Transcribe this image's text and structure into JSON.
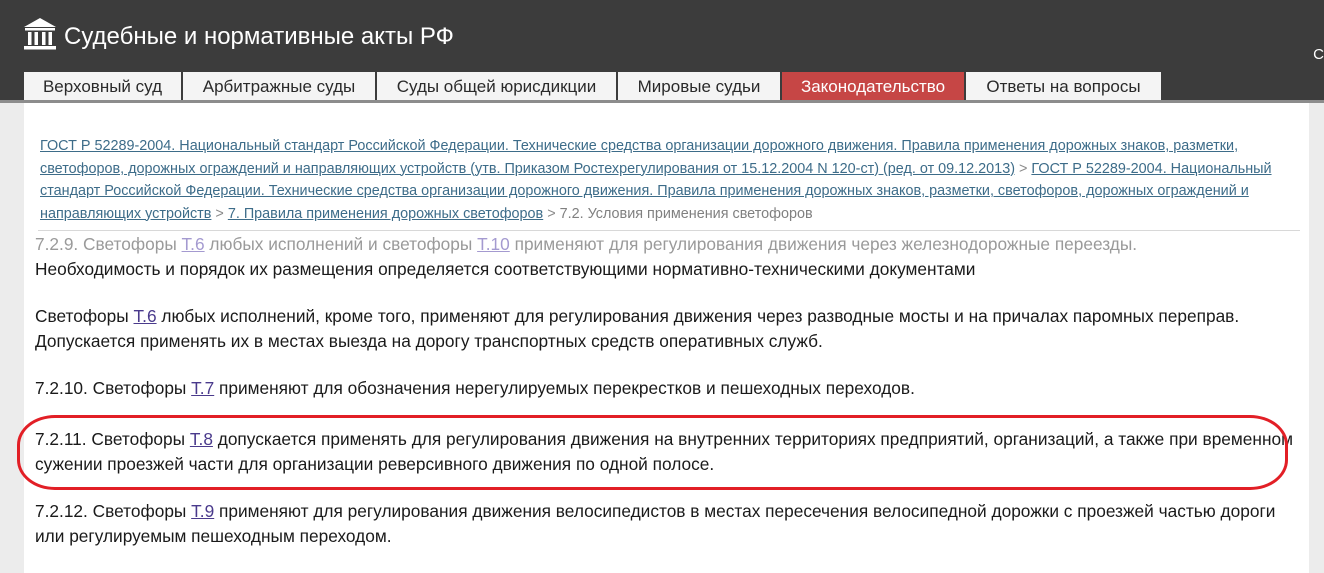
{
  "header": {
    "logo_icon": "courthouse-icon",
    "title": "Судебные и нормативные акты РФ",
    "corner_text": "С"
  },
  "nav": {
    "tabs": [
      {
        "label": "Верховный суд",
        "active": false
      },
      {
        "label": "Арбитражные суды",
        "active": false
      },
      {
        "label": "Суды общей юрисдикции",
        "active": false
      },
      {
        "label": "Мировые судьи",
        "active": false
      },
      {
        "label": "Законодательство",
        "active": true
      },
      {
        "label": "Ответы на вопросы",
        "active": false
      }
    ]
  },
  "breadcrumb": {
    "link1": "ГОСТ Р 52289-2004. Национальный стандарт Российской Федерации. Технические средства организации дорожного движения. Правила применения дорожных знаков, разметки, светофоров, дорожных ограждений и направляющих устройств (утв. Приказом Ростехрегулирования от 15.12.2004 N 120-ст) (ред. от 09.12.2013)",
    "link2": "ГОСТ Р 52289-2004. Национальный стандарт Российской Федерации. Технические средства организации дорожного движения. Правила применения дорожных знаков, разметки, светофоров, дорожных ограждений и направляющих устройств",
    "link3": "7. Правила применения дорожных светофоров",
    "current": "7.2. Условия применения светофоров",
    "separator": ">"
  },
  "content": {
    "p1": {
      "faded_a": "7.2.9. Светофоры ",
      "link_a": "Т.6",
      "faded_b": " любых исполнений и светофоры ",
      "link_b": "Т.10",
      "faded_c": " применяют для регулирования движения через железнодорожные переезды.",
      "rest": "Необходимость и порядок их размещения определяется соответствующими нормативно-техническими документами"
    },
    "p2": {
      "a": "Светофоры ",
      "link": "Т.6",
      "b": " любых исполнений, кроме того, применяют для регулирования движения через разводные мосты и на причалах паромных переправ. Допускается применять их в местах выезда на дорогу транспортных средств оперативных служб."
    },
    "p3": {
      "a": "7.2.10. Светофоры ",
      "link": "Т.7",
      "b": " применяют для обозначения нерегулируемых перекрестков и пешеходных переходов."
    },
    "p4": {
      "a": "7.2.11. Светофоры ",
      "link": "Т.8",
      "b": " допускается применять для регулирования движения на внутренних территориях предприятий, организаций, а также при временном сужении проезжей части для организации реверсивного движения по одной полосе."
    },
    "p5": {
      "a": "7.2.12. Светофоры ",
      "link": "Т.9",
      "b": " применяют для регулирования движения велосипедистов в местах пересечения велосипедной дорожки с проезжей частью дороги или регулируемым пешеходным переходом."
    }
  },
  "colors": {
    "header_bg": "#3c3c3c",
    "active_tab": "#c64645",
    "link": "#3d6c89",
    "annotation_red": "#e21f26"
  }
}
